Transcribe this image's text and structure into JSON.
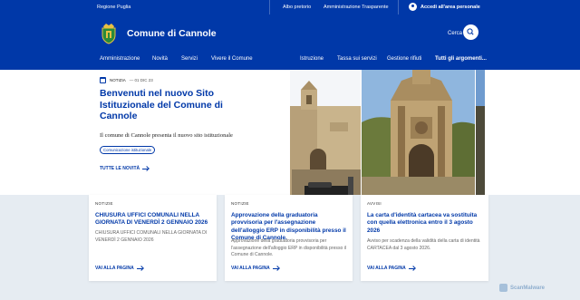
{
  "topbar": {
    "region": "Regione Puglia",
    "links": [
      "Albo pretorio",
      "Amministrazione Trasparente"
    ],
    "login": "Accedi all'area personale"
  },
  "header": {
    "site_title": "Comune di Cannole",
    "search_label": "Cerca",
    "nav_left": [
      "Amministrazione",
      "Novità",
      "Servizi",
      "Vivere il Comune"
    ],
    "nav_right": [
      "Istruzione",
      "Tassa sui servizi",
      "Gestione rifiuti",
      "Tutti gli argomenti..."
    ]
  },
  "hero": {
    "badge": "NOTIZIA",
    "date": "— 01 DIC 23",
    "title": "Benvenuti nel nuovo Sito Istituzionale del Comune di Cannole",
    "description": "Il comune di Cannole presenta il nuovo sito istituzionale",
    "chip": "Comunicazione istituzionale",
    "link": "TUTTE LE NOVITÀ"
  },
  "cards": [
    {
      "category": "NOTIZIE",
      "title": "CHIUSURA UFFICI COMUNALI NELLA GIORNATA DI VENERDÌ 2 GENNAIO 2026",
      "description": "CHIUSURA UFFICI COMUNALI NELLA GIORNATA DI VENERDÌ 2 GENNAIO 2026",
      "link": "VAI ALLA PAGINA"
    },
    {
      "category": "NOTIZIE",
      "title": "Approvazione della graduatoria provvisoria per l'assegnazione dell'alloggio ERP in disponibilità presso il Comune di Cannole.",
      "description": "Approvazione della graduatoria provvisoria per l'assegnazione dell'alloggio ERP in disponibilità presso il Comune di Cannole.",
      "link": "VAI ALLA PAGINA"
    },
    {
      "category": "AVVISI",
      "title": "La carta d'identità cartacea va sostituita con quella elettronica entro il 3 agosto 2026",
      "description": "Avviso per scadenza della validità della carta di identità CARTACEA dal 3 agosto 2026.",
      "link": "VAI ALLA PAGINA"
    }
  ],
  "watermark": "ScanMalware",
  "colors": {
    "brand_blue": "#0038a8",
    "page_bg": "#e6ecf2",
    "card_bg": "#ffffff"
  }
}
